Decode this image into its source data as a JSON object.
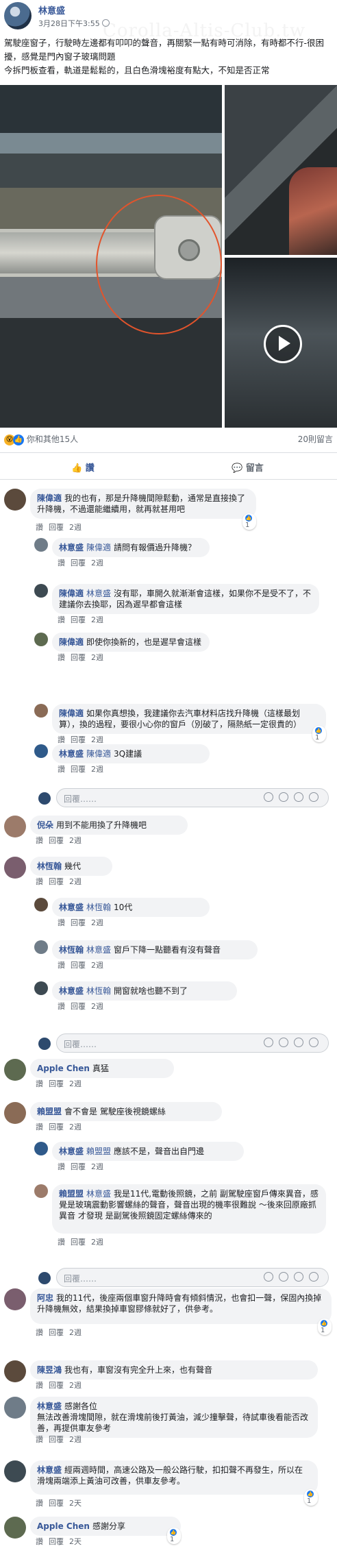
{
  "watermark": "Corolla-Altis-Club.tw",
  "post": {
    "author": "林意盛",
    "time": "3月28日下午3:55",
    "text": "駕駛座窗子，行駛時左邊都有叩叩的聲音，再關緊一點有時可消除，有時都不行-很困擾，感覺是門內窗子玻璃問題\n今拆門板查看，軌道是鬆鬆的，且白色滑塊裕度有點大，不知是否正常",
    "reactions_text": "你和其他15人",
    "comments_count": "20則留言",
    "like_label": "讚",
    "comment_label": "留言"
  },
  "ui": {
    "like": "讚",
    "reply": "回覆",
    "reply_placeholder": "回覆……"
  },
  "comments": [
    {
      "author": "陳偉適",
      "text": "我的也有，那是升降機間隙鬆動，通常是直接換了升降機，不過還能繼續用，就再就甚用吧",
      "time": "2週",
      "likes": "1"
    },
    {
      "author": "林意盛",
      "tag": "陳偉適",
      "text": "請問有報價過升降機？",
      "time": "2週"
    },
    {
      "author": "陳偉適",
      "tag": "林意盛",
      "text": "沒有耶，車開久就漸漸會這樣，如果你不是受不了，不建議你去換耶，因為遲早都會這樣",
      "time": "2週"
    },
    {
      "author": "陳偉適",
      "text": "即使你換新的，也是遲早會這樣",
      "time": "2週"
    },
    {
      "author": "陳偉適",
      "text": "如果你真想換，我建議你去汽車材料店找升降機（這樣最划算），換的過程，要很小心你的窗戶（別破了，隔熱紙一定很貴的）",
      "time": "2週",
      "likes": "1"
    },
    {
      "author": "林意盛",
      "tag": "陳偉適",
      "text": "3Q建議",
      "time": "2週"
    },
    {
      "author": "倪朵",
      "text": "用到不能用換了升降機吧",
      "time": "2週"
    },
    {
      "author": "林恆翰",
      "text": "幾代",
      "time": "2週"
    },
    {
      "author": "林意盛",
      "tag": "林恆翰",
      "text": "10代",
      "time": "2週"
    },
    {
      "author": "林恆翰",
      "tag": "林意盛",
      "text": "窗戶下降一點聽看有沒有聲音",
      "time": "2週"
    },
    {
      "author": "林意盛",
      "tag": "林恆翰",
      "text": "開窗就啥也聽不到了",
      "time": "2週"
    },
    {
      "author": "Apple Chen",
      "text": "真猛",
      "time": "2週"
    },
    {
      "author": "賴盟盟",
      "text": "會不會是 駕駛座後視鏡螺絲",
      "time": "2週"
    },
    {
      "author": "林意盛",
      "tag": "賴盟盟",
      "text": "應該不是，聲音出自門邊",
      "time": "2週"
    },
    {
      "author": "賴盟盟",
      "tag": "林意盛",
      "text": "我是11代,電動後照鏡，之前 副駕駛座窗戶傳來異音，感覺是玻璃震動影響螺絲的聲音，聲音出現的機率很難說 ～後來回原廠抓異音 才發現 是副駕後照鏡固定螺絲傳來的",
      "time": "2週"
    },
    {
      "author": "阿忠",
      "text": "我的11代，後座兩個車窗升降時會有傾斜情況，也會扣一聲，保固內換掉升降機無效，結果換掉車窗膠條就好了，供參考。",
      "time": "2週",
      "likes": "1"
    },
    {
      "author": "陳昱鴻",
      "text": "我也有，車窗沒有完全升上來，也有聲音",
      "time": "2週"
    },
    {
      "author": "林意盛",
      "text": "感謝各位\n無法改善滑塊間隙，就在滑塊前後打黃油，減少撞擊聲，待試車後看能否改善，再提供車友參考",
      "time": "2週"
    },
    {
      "author": "林意盛",
      "text": "經兩週時間，高速公路及一般公路行駛，扣扣聲不再發生，所以在滑塊兩端添上黃油可改善，供車友參考。",
      "time": "2天",
      "likes": "1"
    },
    {
      "author": "Apple Chen",
      "text": "感謝分享",
      "time": "2天",
      "likes": "1"
    }
  ]
}
